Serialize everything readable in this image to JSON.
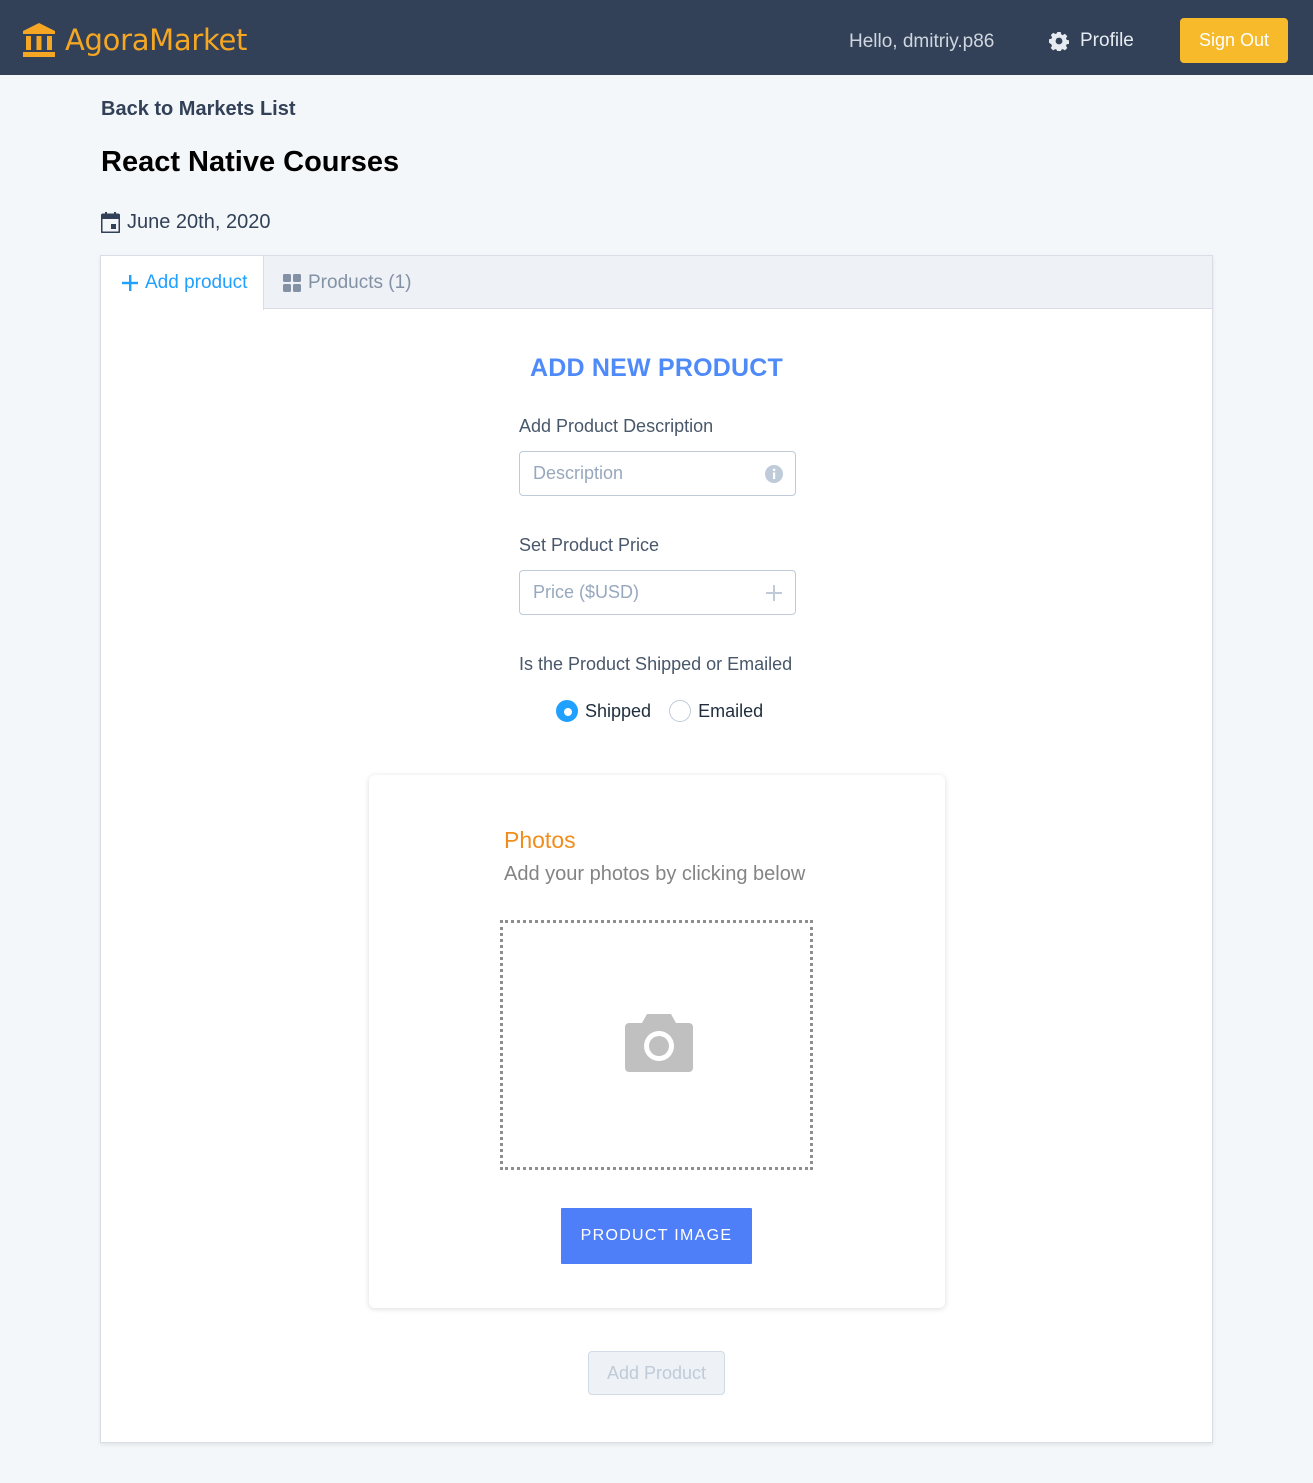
{
  "header": {
    "brand_name": "AgoraMarket",
    "brand_color": "#f5a623",
    "greeting": "Hello, dmitriy.p86",
    "profile_label": "Profile",
    "sign_out_label": "Sign Out",
    "icons": [
      "bank-icon",
      "gear-icon"
    ]
  },
  "page": {
    "back_link": "Back to Markets List",
    "market_title": "React Native Courses",
    "market_date": "June 20th, 2020",
    "date_icon": "calendar-icon"
  },
  "tabs": [
    {
      "label": "Add product",
      "icon": "plus-icon",
      "active": true
    },
    {
      "label": "Products (1)",
      "icon": "grid-icon",
      "active": false
    }
  ],
  "form": {
    "title": "ADD NEW PRODUCT",
    "description_label": "Add Product Description",
    "description_placeholder": "Description",
    "description_value": "",
    "price_label": "Set Product Price",
    "price_placeholder": "Price ($USD)",
    "price_value": "",
    "shipping_label": "Is the Product Shipped or Emailed",
    "shipping_options": [
      {
        "label": "Shipped",
        "checked": true
      },
      {
        "label": "Emailed",
        "checked": false
      }
    ],
    "submit_label": "Add Product",
    "submit_disabled": true
  },
  "photos": {
    "title": "Photos",
    "subtitle": "Add your photos by clicking below",
    "upload_button_label": "PRODUCT IMAGE",
    "dropzone_icon": "camera-icon"
  },
  "colors": {
    "navbar": "#324157",
    "accent_blue": "#4f8af9",
    "active_tab": "#20a0ff",
    "sign_out": "#f7ba2a",
    "photos_title": "#f08d1c",
    "upload_button": "#4f7ff8"
  }
}
